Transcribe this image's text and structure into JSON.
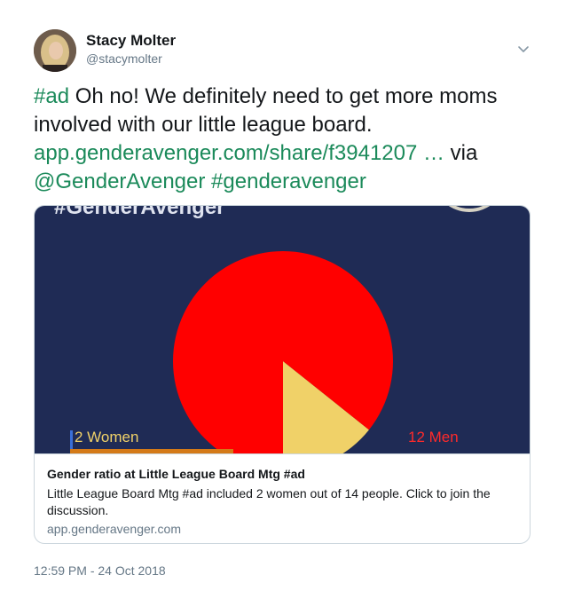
{
  "author": {
    "name": "Stacy Molter",
    "handle": "@stacymolter"
  },
  "tweet": {
    "hashtag_ad": "#ad",
    "text_main": " Oh no! We definitely need to get more moms involved with our little league board. ",
    "link_url": "app.genderavenger.com/share/f3941207 …",
    "text_via": " via ",
    "mention": "@GenderAvenger",
    "hashtag_brand": "#genderavenger"
  },
  "card": {
    "media": {
      "brand_text": "#GenderAvenger",
      "women_label": "2 Women",
      "men_label": "12 Men"
    },
    "title": "Gender ratio at Little League Board Mtg #ad",
    "description": "Little League Board Mtg #ad included 2 women out of 14 people. Click to join the discussion.",
    "domain": "app.genderavenger.com"
  },
  "timestamp": "12:59 PM - 24 Oct 2018",
  "colors": {
    "link": "#1b8a5a",
    "media_bg": "#1f2b55",
    "men": "#ff0000",
    "women": "#f0d168"
  },
  "chart_data": {
    "type": "pie",
    "categories": [
      "2 Women",
      "12 Men"
    ],
    "values": [
      2,
      12
    ]
  }
}
